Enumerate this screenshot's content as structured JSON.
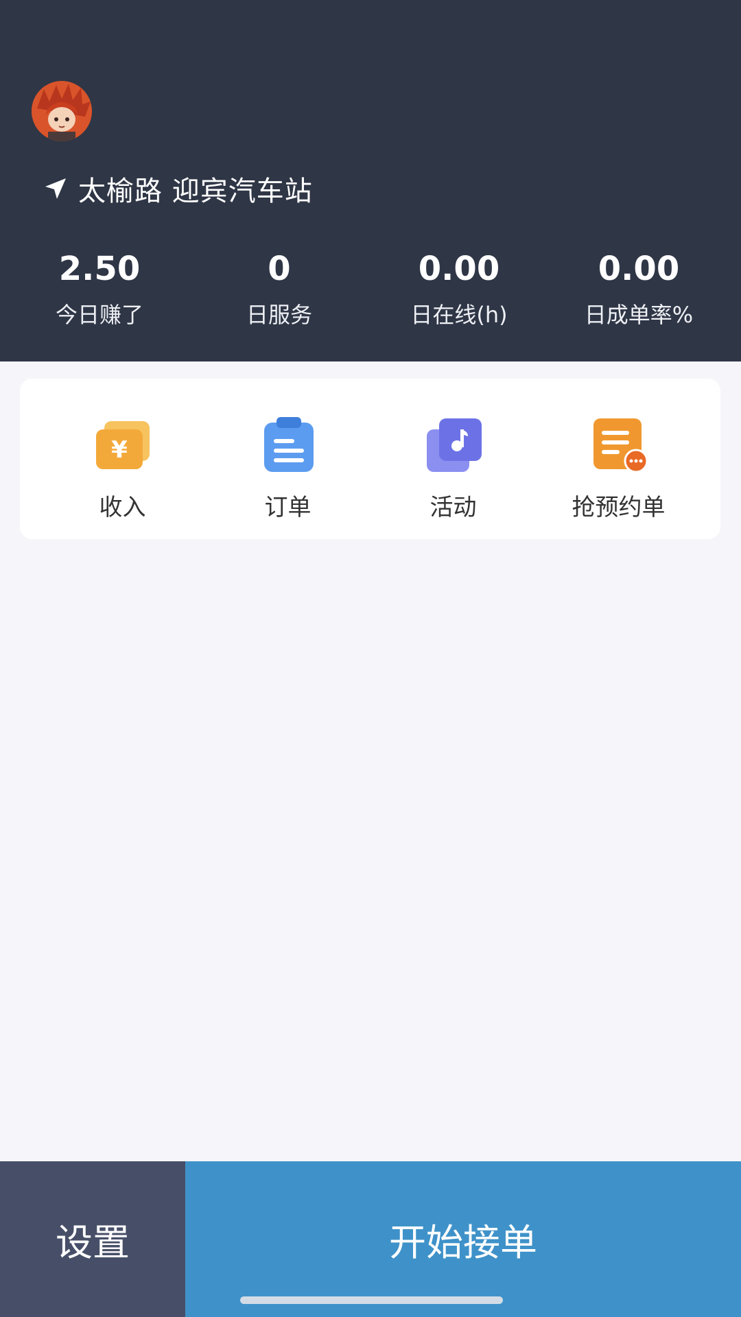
{
  "header": {
    "location": "太榆路 迎宾汽车站",
    "stats": [
      {
        "value": "2.50",
        "label": "今日赚了"
      },
      {
        "value": "0",
        "label": "日服务"
      },
      {
        "value": "0.00",
        "label": "日在线(h)"
      },
      {
        "value": "0.00",
        "label": "日成单率%"
      }
    ]
  },
  "menu": [
    {
      "label": "收入",
      "icon": "income-icon",
      "color": "#f3a93a"
    },
    {
      "label": "订单",
      "icon": "order-icon",
      "color": "#5c9cf0"
    },
    {
      "label": "活动",
      "icon": "activity-icon",
      "color": "#6c72e6"
    },
    {
      "label": "抢预约单",
      "icon": "reservation-order-icon",
      "color": "#f0982f"
    }
  ],
  "bottom": {
    "settings_label": "设置",
    "start_label": "开始接单"
  },
  "colors": {
    "header_bg": "#2f3646",
    "start_button": "#3f92c9",
    "settings_button": "#474f68"
  }
}
